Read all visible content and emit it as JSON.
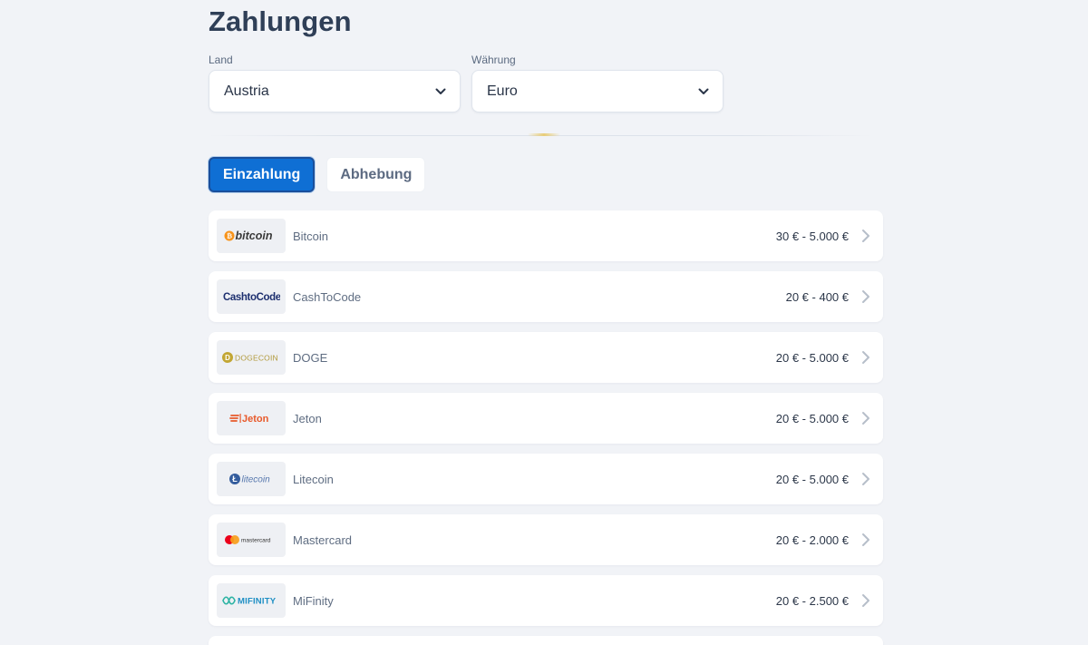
{
  "page": {
    "title": "Zahlungen"
  },
  "filters": {
    "land": {
      "label": "Land",
      "value": "Austria"
    },
    "currency": {
      "label": "Währung",
      "value": "Euro"
    }
  },
  "tabs": [
    {
      "label": "Einzahlung",
      "active": true
    },
    {
      "label": "Abhebung",
      "active": false
    }
  ],
  "methods": [
    {
      "name": "Bitcoin",
      "range": "30 € - 5.000 €",
      "logo": "bitcoin",
      "logo_text": "bitcoin",
      "logo_color": "#f7931a"
    },
    {
      "name": "CashToCode",
      "range": "20 € - 400 €",
      "logo": "cashtocode",
      "logo_text": "CashtoCode",
      "logo_color": "#1d2f6f"
    },
    {
      "name": "DOGE",
      "range": "20 € - 5.000 €",
      "logo": "dogecoin",
      "logo_text": "DOGECOIN",
      "logo_color": "#c2a633"
    },
    {
      "name": "Jeton",
      "range": "20 € - 5.000 €",
      "logo": "jeton",
      "logo_text": "Jeton",
      "logo_color": "#e8592a"
    },
    {
      "name": "Litecoin",
      "range": "20 € - 5.000 €",
      "logo": "litecoin",
      "logo_text": "litecoin",
      "logo_color": "#345d9d"
    },
    {
      "name": "Mastercard",
      "range": "20 € - 2.000 €",
      "logo": "mastercard",
      "logo_text": "mastercard",
      "logo_color": "#eb001b"
    },
    {
      "name": "MiFinity",
      "range": "20 € - 2.500 €",
      "logo": "mifinity",
      "logo_text": "MIFINITY",
      "logo_color": "#1f8fc4"
    }
  ],
  "colors": {
    "accent": "#0f6fd4",
    "background": "#f1f3f7"
  }
}
